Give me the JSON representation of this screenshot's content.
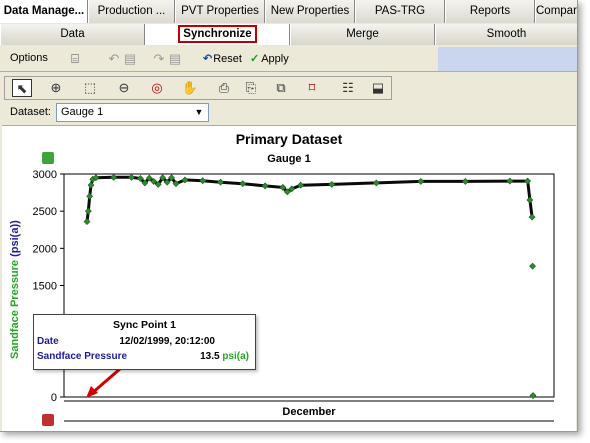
{
  "top_tabs": [
    "Data Manage...",
    "Production ...",
    "PVT Properties",
    "New Properties",
    "PAS-TRG",
    "Reports",
    "Compari"
  ],
  "sub_tabs": [
    "Data",
    "Synchronize",
    "Merge",
    "Smooth"
  ],
  "toolbar": {
    "options_label": "Options",
    "reset_label": "Reset",
    "apply_label": "Apply"
  },
  "dataset": {
    "label": "Dataset:",
    "value": "Gauge 1"
  },
  "chart_data": {
    "type": "scatter",
    "title": "Primary Dataset",
    "subtitle": "Gauge 1",
    "ylabel": "Sandface Pressure",
    "ylabel_unit": "(psi(a))",
    "xlabel": "December",
    "ylim": [
      0,
      3000
    ],
    "yticks": [
      0,
      500,
      1000,
      1500,
      2000,
      2500,
      3000
    ],
    "series": [
      {
        "color": "#2e8b2e",
        "points": [
          [
            0.0,
            2360
          ],
          [
            0.3,
            2500
          ],
          [
            0.6,
            2700
          ],
          [
            0.9,
            2850
          ],
          [
            1.3,
            2930
          ],
          [
            2,
            2950
          ],
          [
            6,
            2955
          ],
          [
            10,
            2955
          ],
          [
            12,
            2940
          ],
          [
            13,
            2880
          ],
          [
            14,
            2945
          ],
          [
            15,
            2900
          ],
          [
            16,
            2860
          ],
          [
            17,
            2950
          ],
          [
            18,
            2890
          ],
          [
            19,
            2950
          ],
          [
            20,
            2870
          ],
          [
            22,
            2920
          ],
          [
            26,
            2910
          ],
          [
            30,
            2890
          ],
          [
            35,
            2870
          ],
          [
            40,
            2840
          ],
          [
            44,
            2820
          ],
          [
            45,
            2760
          ],
          [
            46,
            2800
          ],
          [
            48,
            2850
          ],
          [
            55,
            2860
          ],
          [
            65,
            2880
          ],
          [
            75,
            2900
          ],
          [
            85,
            2900
          ],
          [
            95,
            2905
          ],
          [
            99,
            2905
          ],
          [
            99.5,
            2650
          ],
          [
            100,
            2420
          ],
          [
            100.1,
            1760
          ],
          [
            100.2,
            20
          ]
        ]
      }
    ],
    "annotation": {
      "title": "Sync Point 1",
      "date_label": "Date",
      "date_value": "12/02/1999, 20:12:00",
      "pressure_label": "Sandface Pressure",
      "pressure_value": "13.5",
      "pressure_unit": "psi(a)"
    }
  },
  "colors": {
    "accent_red": "#c00000",
    "series_green": "#2e8b2e",
    "unit_blue": "#1c1c9c"
  }
}
